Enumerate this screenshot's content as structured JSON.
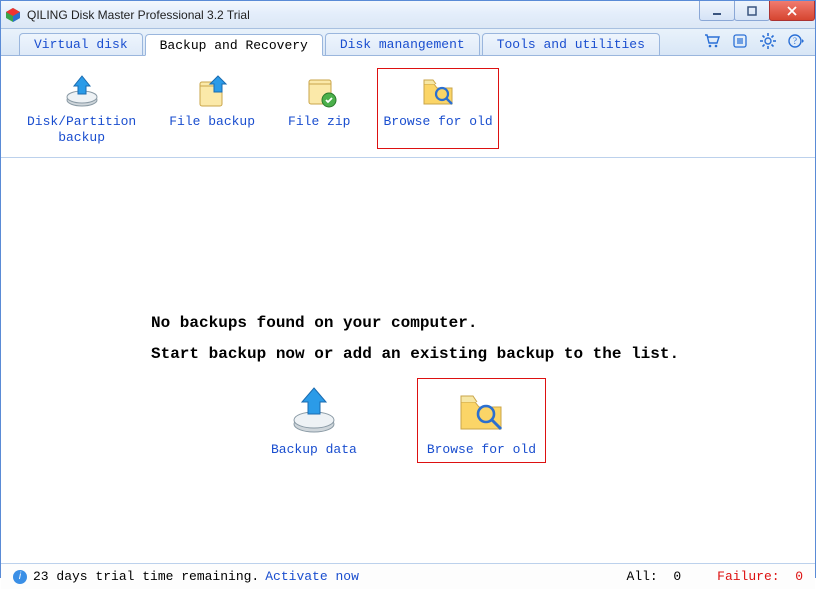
{
  "window": {
    "title": "QILING Disk Master Professional 3.2 Trial"
  },
  "tabs": [
    {
      "label": "Virtual disk"
    },
    {
      "label": "Backup and Recovery"
    },
    {
      "label": "Disk manangement"
    },
    {
      "label": "Tools and utilities"
    }
  ],
  "activeTab": 1,
  "toolbar": [
    {
      "label": "Disk/Partition",
      "label2": "backup"
    },
    {
      "label": "File backup",
      "label2": ""
    },
    {
      "label": "File zip",
      "label2": ""
    },
    {
      "label": "Browse for old",
      "label2": ""
    }
  ],
  "content": {
    "line1": "No backups found on your computer.",
    "line2": "Start backup now or add an existing backup to the list.",
    "buttons": [
      {
        "label": "Backup data"
      },
      {
        "label": "Browse for old"
      }
    ]
  },
  "status": {
    "trial": "23 days trial time remaining.",
    "activate": "Activate now",
    "allLabel": "All:",
    "allCount": "0",
    "failureLabel": "Failure:",
    "failureCount": "0"
  }
}
